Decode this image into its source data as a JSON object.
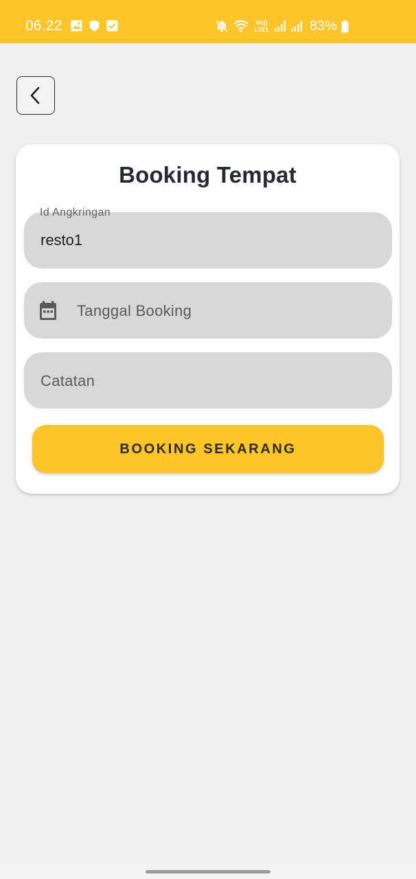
{
  "status_bar": {
    "time": "06.22",
    "left_icons": [
      "gallery-icon",
      "shield-icon",
      "check-box-icon"
    ],
    "right_icons": [
      "mute-icon",
      "wifi-icon",
      "volte-icon",
      "signal-icon",
      "signal-icon",
      "battery-icon"
    ],
    "volte_text": [
      "Vo))",
      "LTE1"
    ],
    "battery_percent": "83%",
    "color": "#fec52b"
  },
  "back_button": {
    "icon": "chevron-left-icon"
  },
  "card": {
    "title": "Booking Tempat",
    "fields": {
      "id_angkringan": {
        "label": "Id Angkringan",
        "value": "resto1"
      },
      "tanggal_booking": {
        "placeholder": "Tanggal Booking",
        "icon": "calendar-icon"
      },
      "catatan": {
        "placeholder": "Catatan"
      }
    },
    "submit_label": "BOOKING SEKARANG"
  },
  "colors": {
    "accent": "#fec52b",
    "background": "#efefef",
    "field_bg": "#d8d8d8",
    "text_dark": "#262a2e"
  }
}
